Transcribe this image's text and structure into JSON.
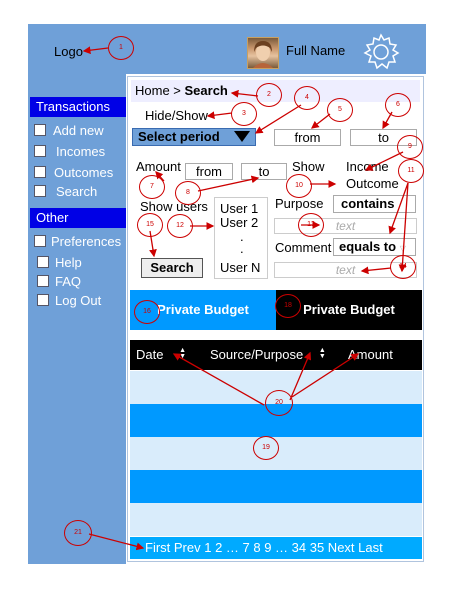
{
  "header": {
    "logo": "Logo",
    "user_name": "Full Name"
  },
  "sidebar": {
    "transactions_title": "Transactions",
    "transactions": [
      "Add new",
      "Incomes",
      "Outcomes",
      "Search"
    ],
    "other_title": "Other",
    "other": [
      "Preferences",
      "Help",
      "FAQ",
      "Log Out"
    ]
  },
  "breadcrumb": {
    "home": "Home > ",
    "current": "Search"
  },
  "filters": {
    "hide_show": "Hide/Show",
    "select_period": "Select period",
    "period_from": "from",
    "period_to": "to",
    "amount_label": "Amount",
    "amount_from": "from",
    "amount_to": "to",
    "show_label": "Show",
    "show_income": "Income",
    "show_outcome": "Outcome",
    "show_users": "Show users",
    "users": [
      "User 1",
      "User 2",
      ".",
      ".",
      "User N"
    ],
    "purpose_label": "Purpose",
    "purpose_op": "contains",
    "purpose_placeholder": "text",
    "comment_label": "Comment",
    "comment_op": "equals to",
    "comment_placeholder": "text",
    "search_button": "Search"
  },
  "tabs": [
    "Private Budget",
    "Private Budget"
  ],
  "table": {
    "columns": [
      "Date",
      "Source/Purpose",
      "Amount"
    ],
    "rows": 6
  },
  "pager": "First Prev 1 2 … 7 8 9 … 34 35 Next Last",
  "annotations": [
    "1",
    "2",
    "3",
    "4",
    "5",
    "6",
    "7",
    "8",
    "9",
    "10",
    "11",
    "12",
    "13",
    "14",
    "15",
    "16",
    "18",
    "19",
    "20",
    "21"
  ],
  "colors": {
    "header": "#6fa0d8",
    "section": "#0000e6",
    "tab_active": "#0099ff",
    "row_light": "#d9ecfb",
    "row_dark": "#0099ff",
    "annotation": "#cc0000"
  }
}
